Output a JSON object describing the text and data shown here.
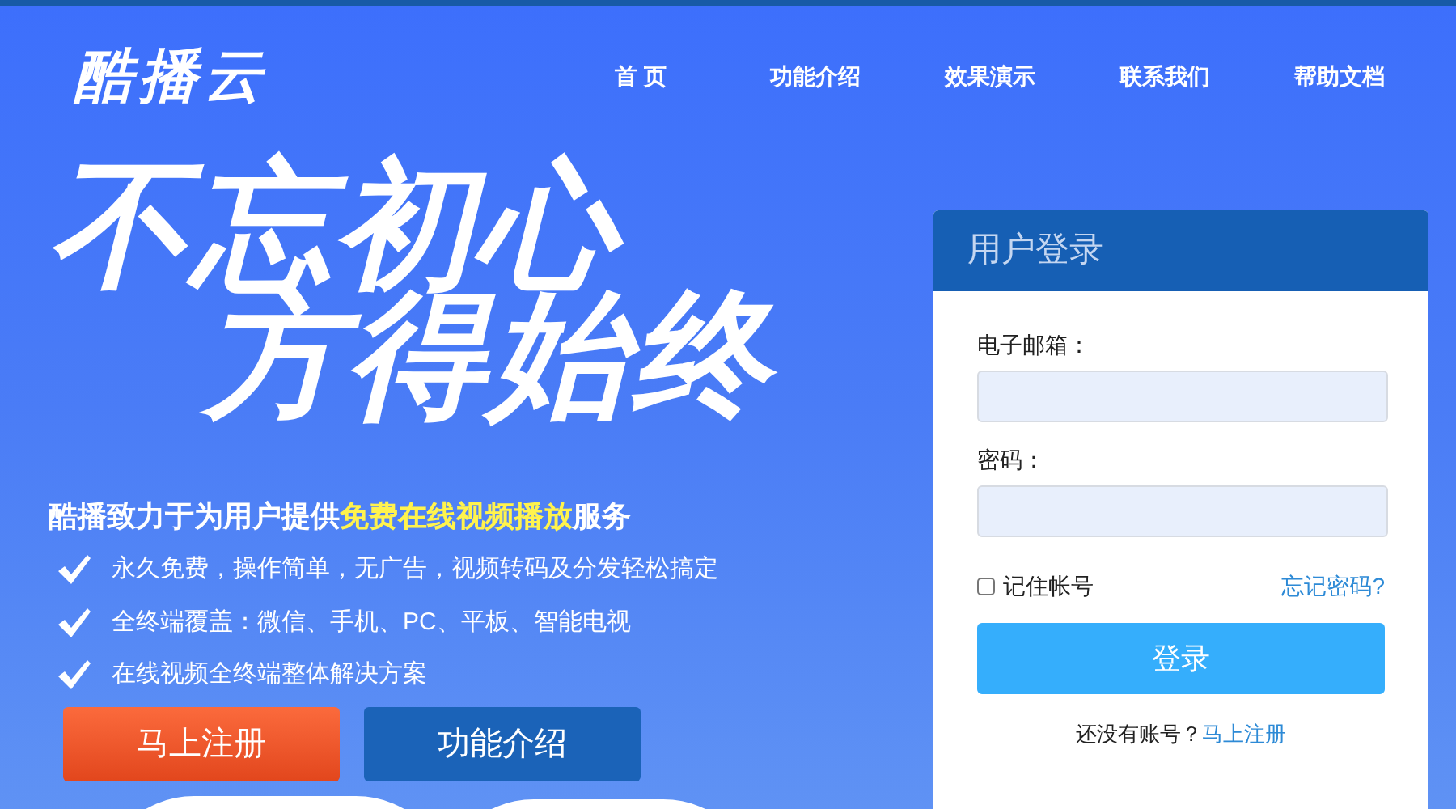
{
  "header": {
    "logo": "酷播云",
    "nav": [
      "首 页",
      "功能介绍",
      "效果演示",
      "联系我们",
      "帮助文档"
    ]
  },
  "hero": {
    "slogan": [
      "不忘初心",
      "方得始终"
    ],
    "headline": "酷播致力于为用户提供**免费在线视频播放**服务",
    "features": [
      "永久免费，操作简单，无广告，视频转码及分发轻松搞定",
      "全终端覆盖：微信、手机、PC、平板、智能电视",
      "在线视频全终端整体解决方案"
    ],
    "buttons": [
      {
        "label": "马上注册",
        "kind": "primary"
      },
      {
        "label": "功能介绍",
        "kind": "secondary"
      }
    ]
  },
  "login": {
    "title": "用户登录",
    "email_label": "电子邮箱：",
    "password_label": "密码：",
    "remember": {
      "label": "记住帐号",
      "checked": false
    },
    "forgot": "忘记密码?",
    "submit": "登录",
    "register_prompt": "还没有账号？",
    "register_link": "马上注册"
  }
}
